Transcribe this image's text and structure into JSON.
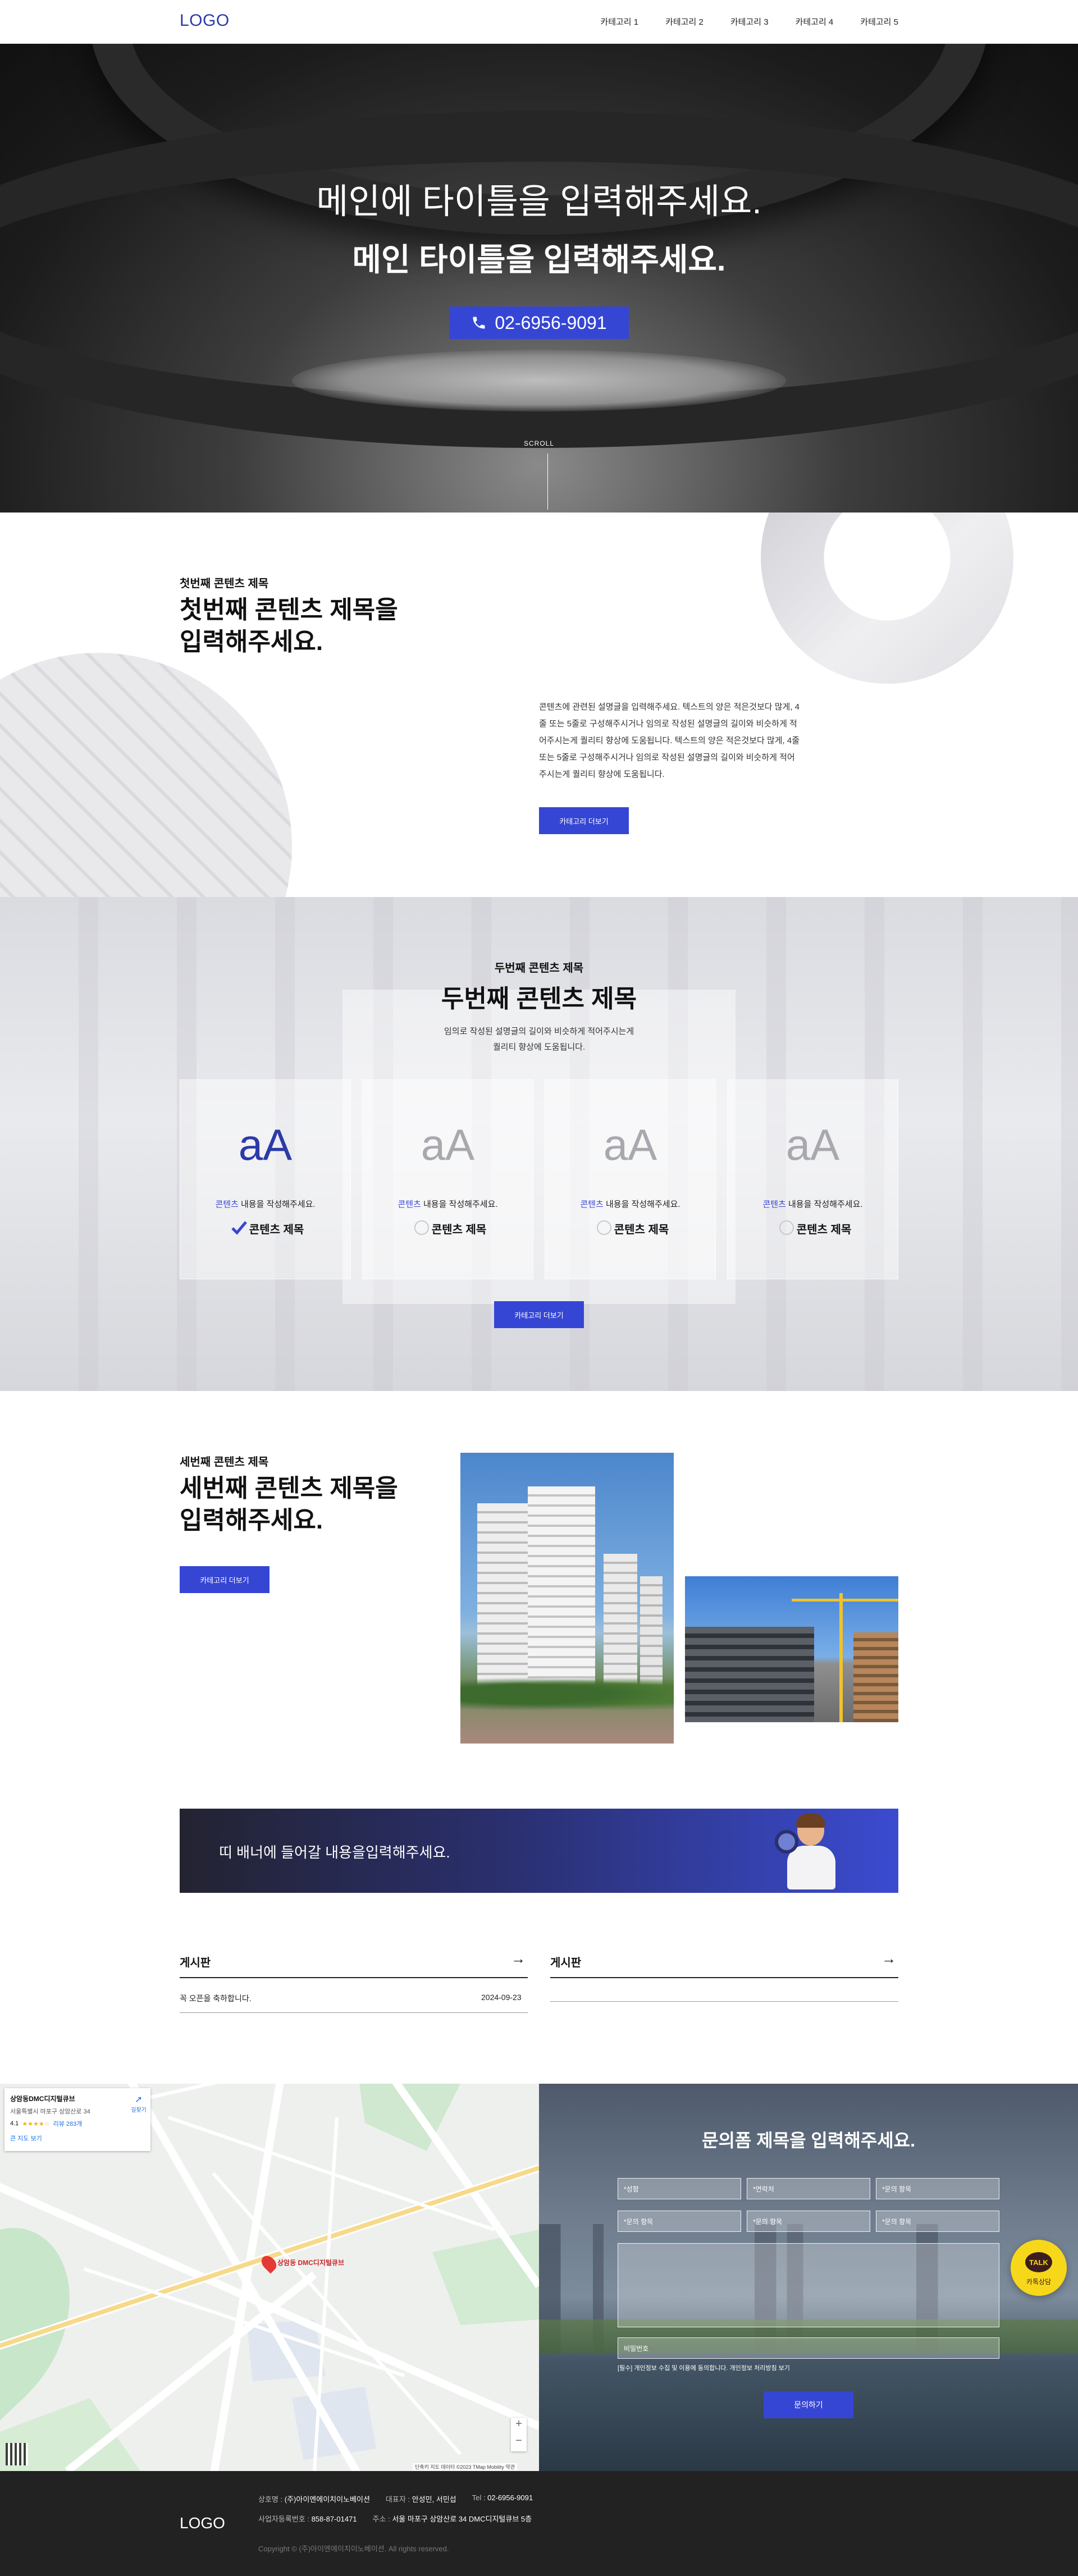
{
  "header": {
    "logo": "LOGO",
    "nav": [
      "카테고리 1",
      "카테고리 2",
      "카테고리 3",
      "카테고리 4",
      "카테고리 5"
    ]
  },
  "hero": {
    "title_light": "메인에 타이틀을 입력해주세요.",
    "title_bold": "메인 타이틀을 입력해주세요.",
    "phone": "02-6956-9091",
    "scroll": "SCROLL"
  },
  "section1": {
    "kicker": "첫번째 콘텐츠 제목",
    "title_line1": "첫번째 콘텐츠 제목을",
    "title_line2": "입력해주세요.",
    "body": "콘텐츠에 관련된 설명글을 입력해주세요. 텍스트의 양은 적은것보다 많게, 4줄 또는 5줄로 구성해주시거나 임의로 작성된 설명글의 길이와 비슷하게 적어주시는게 퀄리티 향상에 도움됩니다. 텍스트의 양은 적은것보다 많게, 4줄 또는 5줄로 구성해주시거나 임의로 작성된 설명글의 길이와 비슷하게 적어주시는게 퀄리티 향상에 도움됩니다.",
    "button": "카테고리 더보기"
  },
  "section2": {
    "kicker": "두번째 콘텐츠 제목",
    "title": "두번째 콘텐츠 제목",
    "sub_line1": "임의로 작성된 설명글의 길이와 비슷하게 적어주시는게",
    "sub_line2": "퀄리티 향상에 도움됩니다.",
    "cards": [
      {
        "icon": "aA",
        "highlight": "콘텐츠",
        "desc": " 내용을 작성해주세요.",
        "title": "콘텐츠 제목",
        "active": true
      },
      {
        "icon": "aA",
        "highlight": "콘텐츠",
        "desc": " 내용을 작성해주세요.",
        "title": "콘텐츠 제목",
        "active": false
      },
      {
        "icon": "aA",
        "highlight": "콘텐츠",
        "desc": " 내용을 작성해주세요.",
        "title": "콘텐츠 제목",
        "active": false
      },
      {
        "icon": "aA",
        "highlight": "콘텐츠",
        "desc": " 내용을 작성해주세요.",
        "title": "콘텐츠 제목",
        "active": false
      }
    ],
    "button": "카테고리 더보기"
  },
  "section3": {
    "kicker": "세번째 콘텐츠 제목",
    "title_line1": "세번째 콘텐츠 제목을",
    "title_line2": "입력해주세요.",
    "button": "카테고리 더보기"
  },
  "banner": {
    "text": "띠 배너에 들어갈 내용을입력해주세요."
  },
  "boards": [
    {
      "title": "게시판",
      "posts": [
        {
          "title": "꼭 오픈을 축하합니다.",
          "date": "2024-09-23"
        }
      ]
    },
    {
      "title": "게시판",
      "posts": []
    }
  ],
  "map": {
    "place_name": "상암동DMC디지털큐브",
    "address": "서울특별시 마포구 상암산로 34",
    "rating": "4.1",
    "reviews": "리뷰 283개",
    "directions": "길찾기",
    "larger_map": "큰 지도 보기",
    "pin_label": "상암동 DMC디지털큐브",
    "footer_note": "단축키   지도 데이터 ©2023 TMap Mobility   약관"
  },
  "form": {
    "title": "문의폼 제목을 입력해주세요.",
    "fields_row1": [
      "*성함",
      "*연락처",
      "*문의 항목"
    ],
    "fields_row2": [
      "*문의 항목",
      "*문의 항목",
      "*문의 항목"
    ],
    "password": "비밀번호",
    "privacy": "[필수] 개인정보 수집 및 이용에 동의합니다. 개인정보 처리방침 보기",
    "submit": "문의하기"
  },
  "kakao": {
    "talk": "TALK",
    "label": "카톡상담"
  },
  "footer": {
    "logo": "LOGO",
    "company_label": "상호명 :",
    "company": "(주)아이엔에이치이노베이션",
    "ceo_label": "대표자 :",
    "ceo": "안성민, 서민섭",
    "tel_label": "Tel :",
    "tel": "02-6956-9091",
    "biz_label": "사업자등록번호 :",
    "biz": "858-87-01471",
    "addr_label": "주소 :",
    "addr": "서울 마포구 상암산로 34 DMC디지털큐브 5층",
    "copyright": "Copyright © (주)아이엔에이치이노베이션. All rights reserved."
  },
  "colors": {
    "accent": "#3646d4",
    "logo": "#2b3aa8",
    "footer_bg": "#222222",
    "kakao": "#f7d71a"
  }
}
